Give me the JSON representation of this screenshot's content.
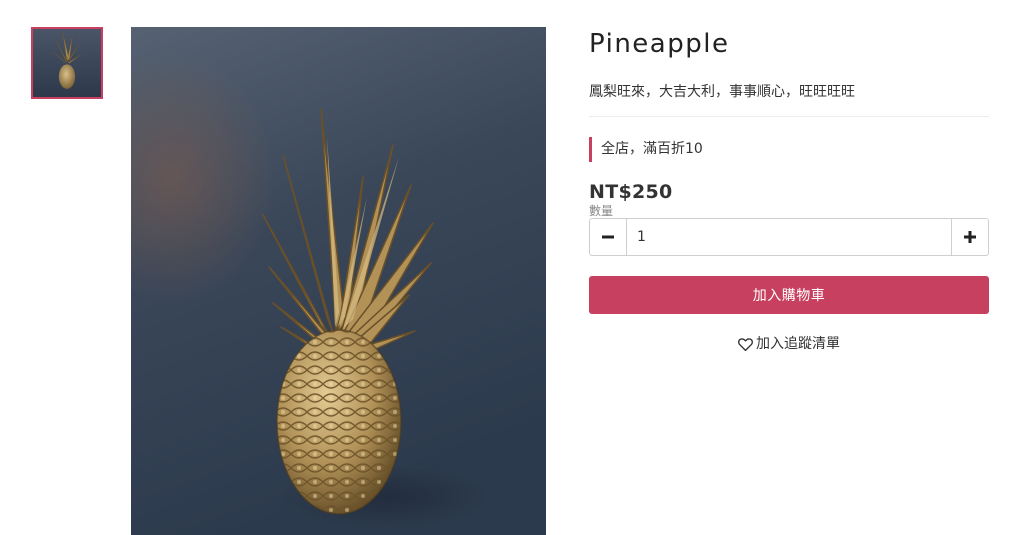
{
  "product": {
    "title": "Pineapple",
    "subtitle": "鳳梨旺來，大吉大利，事事順心，旺旺旺旺",
    "promo": "全店，滿百折10",
    "price": "NT$250",
    "quantity_label": "數量",
    "quantity_value": "1",
    "add_to_cart_label": "加入購物車",
    "wishlist_label": "加入追蹤清單"
  },
  "icons": {
    "minus": "minus-icon",
    "plus": "plus-icon",
    "wishlist": "heart-outline-icon"
  },
  "colors": {
    "accent": "#c7405f",
    "text": "#333333",
    "muted": "#888888",
    "border": "#cfcfcf"
  }
}
